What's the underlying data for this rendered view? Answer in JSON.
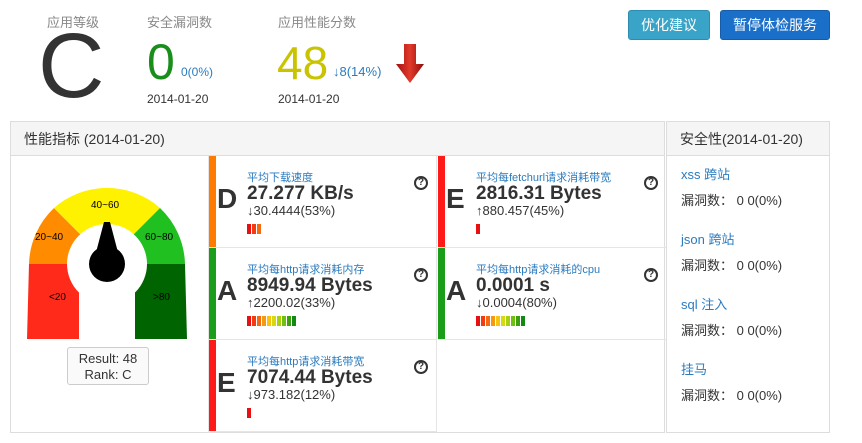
{
  "header": {
    "grade_label": "应用等级",
    "grade": "C",
    "vuln_label": "安全漏洞数",
    "vuln_count": "0",
    "vuln_change": "0(0%)",
    "vuln_date": "2014-01-20",
    "score_label": "应用性能分数",
    "score": "48",
    "score_change": "↓8(14%)",
    "score_date": "2014-01-20"
  },
  "buttons": {
    "optimize": "优化建议",
    "pause": "暂停体检服务"
  },
  "perf_panel": {
    "title": "性能指标 (2014-01-20)"
  },
  "gauge": {
    "labels": [
      "<20",
      "20~40",
      "40~60",
      "60~80",
      ">80"
    ],
    "result": "Result: 48",
    "rank": "Rank: C",
    "colors": [
      "#ff2a1a",
      "#ff8c00",
      "#fff200",
      "#20c020",
      "#006400"
    ]
  },
  "metrics": [
    {
      "grade": "D",
      "name": "平均下载速度",
      "value": "27.277 KB/s",
      "change": "↓30.4444(53%)",
      "color": "#ff7a00",
      "levels": 3
    },
    {
      "grade": "E",
      "name": "平均每fetchurl请求消耗带宽",
      "value": "2816.31 Bytes",
      "change": "↑880.457(45%)",
      "color": "#ff1a1a",
      "levels": 1
    },
    {
      "grade": "A",
      "name": "平均每http请求消耗内存",
      "value": "8949.94 Bytes",
      "change": "↑2200.02(33%)",
      "color": "#1a9e1a",
      "levels": 10
    },
    {
      "grade": "A",
      "name": "平均每http请求消耗的cpu",
      "value": "0.0001 s",
      "change": "↓0.0004(80%)",
      "color": "#1a9e1a",
      "levels": 10
    },
    {
      "grade": "E",
      "name": "平均每http请求消耗带宽",
      "value": "7074.44 Bytes",
      "change": "↓973.182(12%)",
      "color": "#ff1a1a",
      "levels": 1
    }
  ],
  "security_panel": {
    "title": "安全性(2014-01-20)",
    "items": [
      {
        "name": "xss 跨站",
        "value": "漏洞数： 0 0(0%)"
      },
      {
        "name": "json 跨站",
        "value": "漏洞数： 0 0(0%)"
      },
      {
        "name": "sql 注入",
        "value": "漏洞数： 0 0(0%)"
      },
      {
        "name": "挂马",
        "value": "漏洞数： 0 0(0%)"
      }
    ]
  }
}
